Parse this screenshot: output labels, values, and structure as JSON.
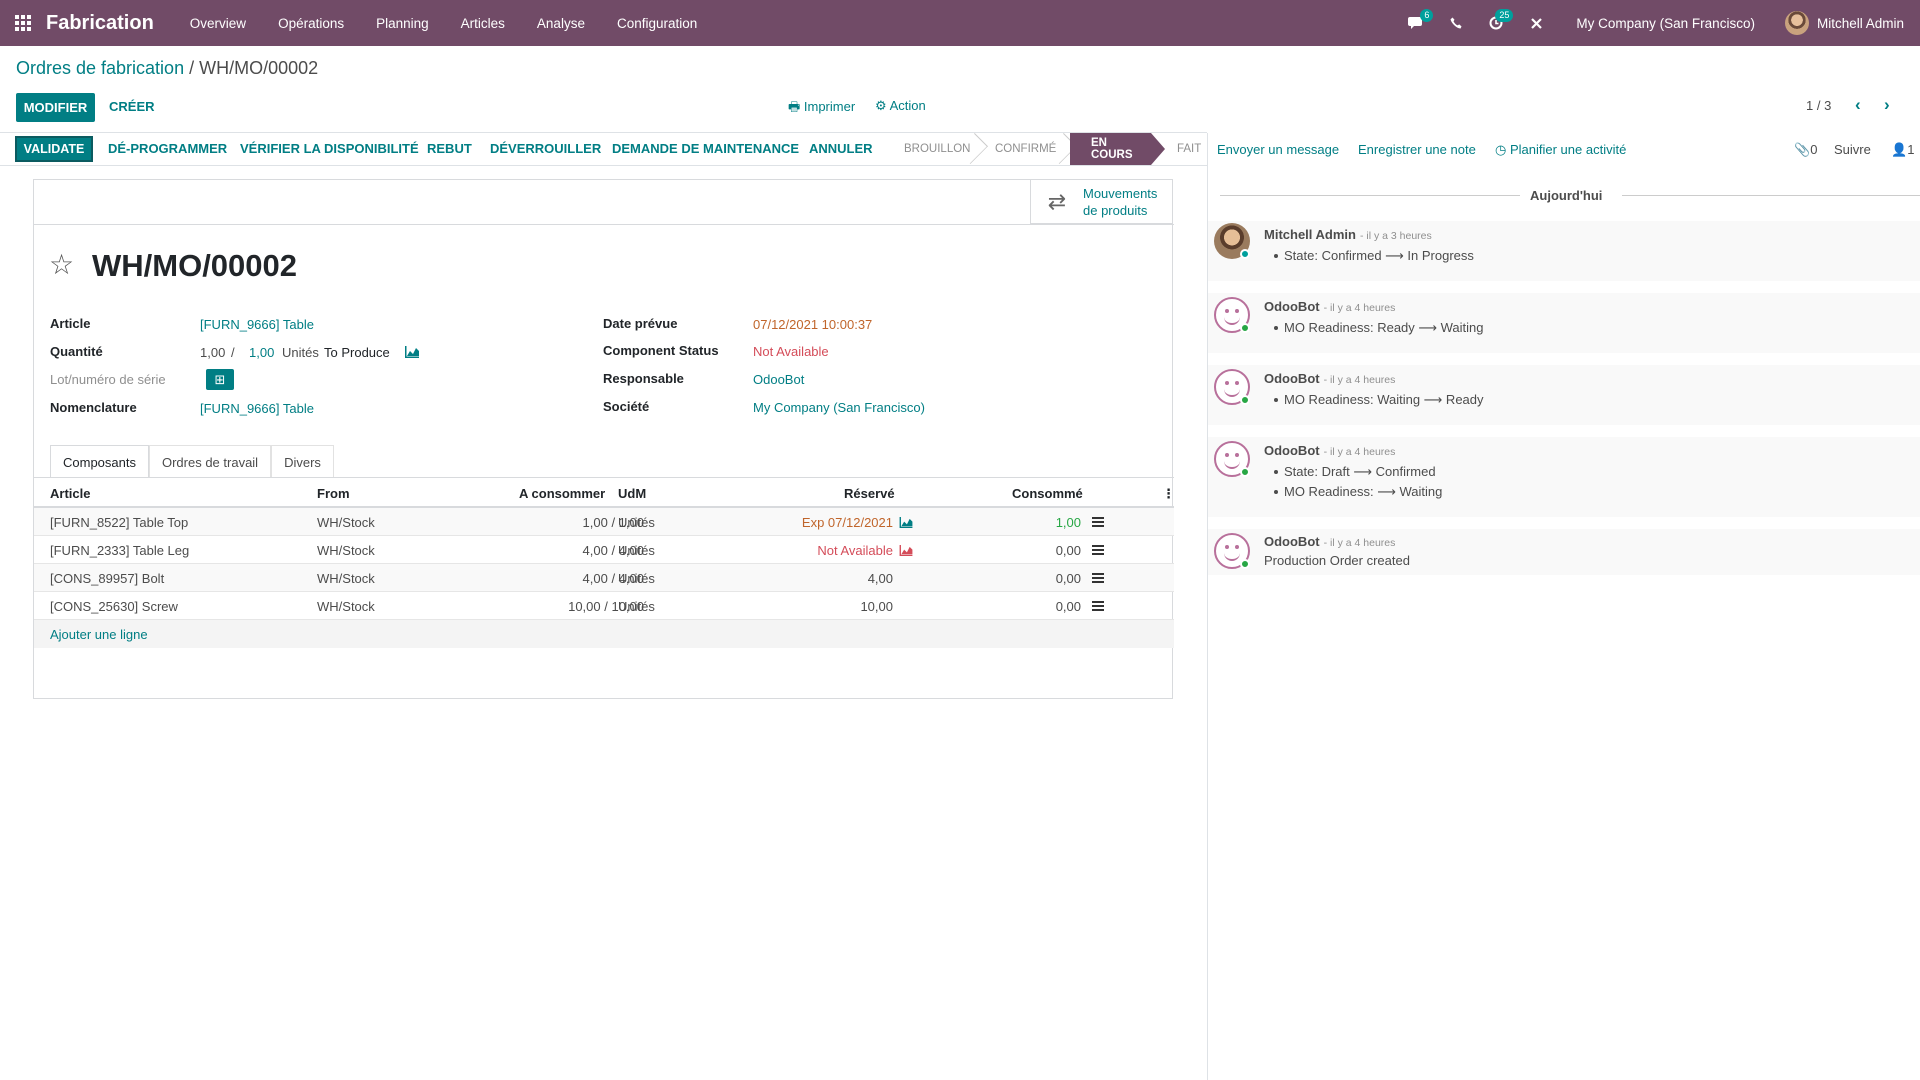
{
  "navbar": {
    "app_name": "Fabrication",
    "menu": [
      "Overview",
      "Opérations",
      "Planning",
      "Articles",
      "Analyse",
      "Configuration"
    ],
    "messages_badge": "6",
    "activities_badge": "25",
    "company": "My Company (San Francisco)",
    "user": "Mitchell Admin",
    "icons": [
      "apps-grid-icon",
      "chat-icon",
      "phone-icon",
      "clock-icon",
      "debug-icon"
    ]
  },
  "breadcrumb": {
    "parent": "Ordres de fabrication",
    "sep": " / ",
    "current": "WH/MO/00002"
  },
  "control": {
    "edit": "MODIFIER",
    "create": "CRÉER",
    "print": "Imprimer",
    "action": "Action",
    "pager": "1 / 3"
  },
  "statusbar": {
    "buttons": [
      "VALIDATE",
      "DÉ-PROGRAMMER",
      "VÉRIFIER LA DISPONIBILITÉ",
      "REBUT",
      "DÉVERROUILLER",
      "DEMANDE DE MAINTENANCE",
      "ANNULER"
    ],
    "states": [
      "BROUILLON",
      "CONFIRMÉ",
      "EN COURS",
      "FAIT"
    ],
    "active_state": "EN COURS"
  },
  "smart_button": {
    "line1": "Mouvements",
    "line2": "de produits"
  },
  "record": {
    "name": "WH/MO/00002",
    "fields_left": {
      "article_label": "Article",
      "article": "[FURN_9666] Table",
      "qty_label": "Quantité",
      "qty_done": "1,00",
      "qty_slash": "/",
      "qty_total": "1,00",
      "qty_uom": "Unités",
      "qty_to_produce": "To Produce",
      "lot_label": "Lot/numéro de série",
      "bom_label": "Nomenclature",
      "bom": "[FURN_9666] Table"
    },
    "fields_right": {
      "date_label": "Date prévue",
      "date": "07/12/2021 10:00:37",
      "status_label": "Component Status",
      "status": "Not Available",
      "resp_label": "Responsable",
      "resp": "OdooBot",
      "company_label": "Société",
      "company": "My Company (San Francisco)"
    }
  },
  "tabs": [
    "Composants",
    "Ordres de travail",
    "Divers"
  ],
  "table": {
    "headers": [
      "Article",
      "From",
      "A consommer",
      "UdM",
      "Réservé",
      "Consommé"
    ],
    "rows": [
      {
        "article": "[FURN_8522] Table Top",
        "from": "WH/Stock",
        "consume": "1,00 / 1,00",
        "uom": "Unités",
        "reserved": "Exp 07/12/2021",
        "consumed": "1,00"
      },
      {
        "article": "[FURN_2333] Table Leg",
        "from": "WH/Stock",
        "consume": "4,00 / 4,00",
        "uom": "Unités",
        "reserved": "Not Available",
        "consumed": "0,00"
      },
      {
        "article": "[CONS_89957] Bolt",
        "from": "WH/Stock",
        "consume": "4,00 / 4,00",
        "uom": "Unités",
        "reserved": "4,00",
        "consumed": "0,00"
      },
      {
        "article": "[CONS_25630] Screw",
        "from": "WH/Stock",
        "consume": "10,00 / 10,00",
        "uom": "Unités",
        "reserved": "10,00",
        "consumed": "0,00"
      }
    ],
    "add_line": "Ajouter une ligne"
  },
  "chatter": {
    "send": "Envoyer un message",
    "note": "Enregistrer une note",
    "activity": "Planifier une activité",
    "attachments": "0",
    "follow": "Suivre",
    "followers": "1",
    "today": "Aujourd'hui",
    "messages": [
      {
        "author": "Mitchell Admin",
        "date": "- il y a 3 heures",
        "lines": [
          "State: Confirmed ⟶ In Progress"
        ]
      },
      {
        "author": "OdooBot",
        "date": "- il y a 4 heures",
        "lines": [
          "MO Readiness: Ready ⟶ Waiting"
        ]
      },
      {
        "author": "OdooBot",
        "date": "- il y a 4 heures",
        "lines": [
          "MO Readiness: Waiting ⟶ Ready"
        ]
      },
      {
        "author": "OdooBot",
        "date": "- il y a 4 heures",
        "lines": [
          "State: Draft ⟶ Confirmed",
          "MO Readiness: ⟶ Waiting"
        ]
      },
      {
        "author": "OdooBot",
        "date": "- il y a 4 heures",
        "text": "Production Order created"
      }
    ]
  }
}
